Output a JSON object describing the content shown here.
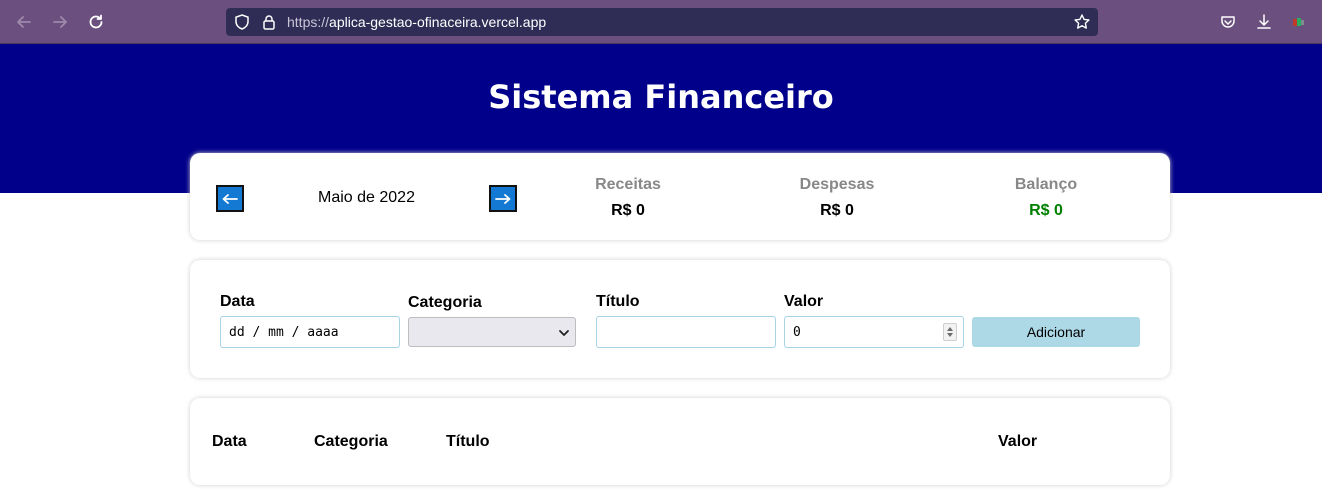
{
  "browser": {
    "url_scheme": "https://",
    "url_host": "aplica-gestao-ofinaceira.vercel.app"
  },
  "header": {
    "title": "Sistema Financeiro"
  },
  "info": {
    "month": "Maio de 2022",
    "receitas_label": "Receitas",
    "receitas_value": "R$ 0",
    "despesas_label": "Despesas",
    "despesas_value": "R$ 0",
    "balanco_label": "Balanço",
    "balanco_value": "R$ 0"
  },
  "form": {
    "data_label": "Data",
    "data_placeholder": "dd / mm / aaaa",
    "categoria_label": "Categoria",
    "titulo_label": "Título",
    "valor_label": "Valor",
    "valor_value": "0",
    "add_label": "Adicionar"
  },
  "table": {
    "columns": [
      "Data",
      "Categoria",
      "Título",
      "Valor"
    ]
  },
  "colors": {
    "header_bg": "#00008b",
    "arrow_btn": "#1479d3",
    "positive": "#008000",
    "add_btn": "#add8e6"
  }
}
